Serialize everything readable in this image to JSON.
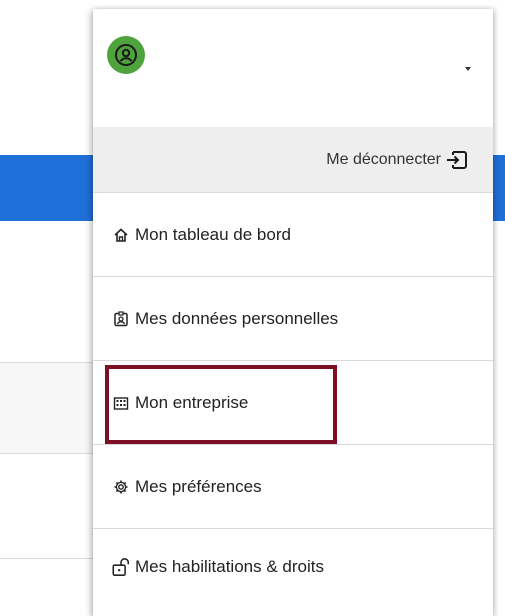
{
  "menu": {
    "logout_label": "Me déconnecter",
    "items": [
      {
        "label": "Mon tableau de bord",
        "icon": "home-icon"
      },
      {
        "label": "Mes données personnelles",
        "icon": "id-badge-icon"
      },
      {
        "label": "Mon entreprise",
        "icon": "building-icon",
        "highlighted": true
      },
      {
        "label": "Mes préférences",
        "icon": "gear-icon"
      },
      {
        "label": "Mes habilitations & droits",
        "icon": "unlock-icon"
      }
    ]
  },
  "colors": {
    "accent_blue": "#1f6fd8",
    "avatar_green": "#4fa33d",
    "highlight_border": "#7b0f23"
  }
}
